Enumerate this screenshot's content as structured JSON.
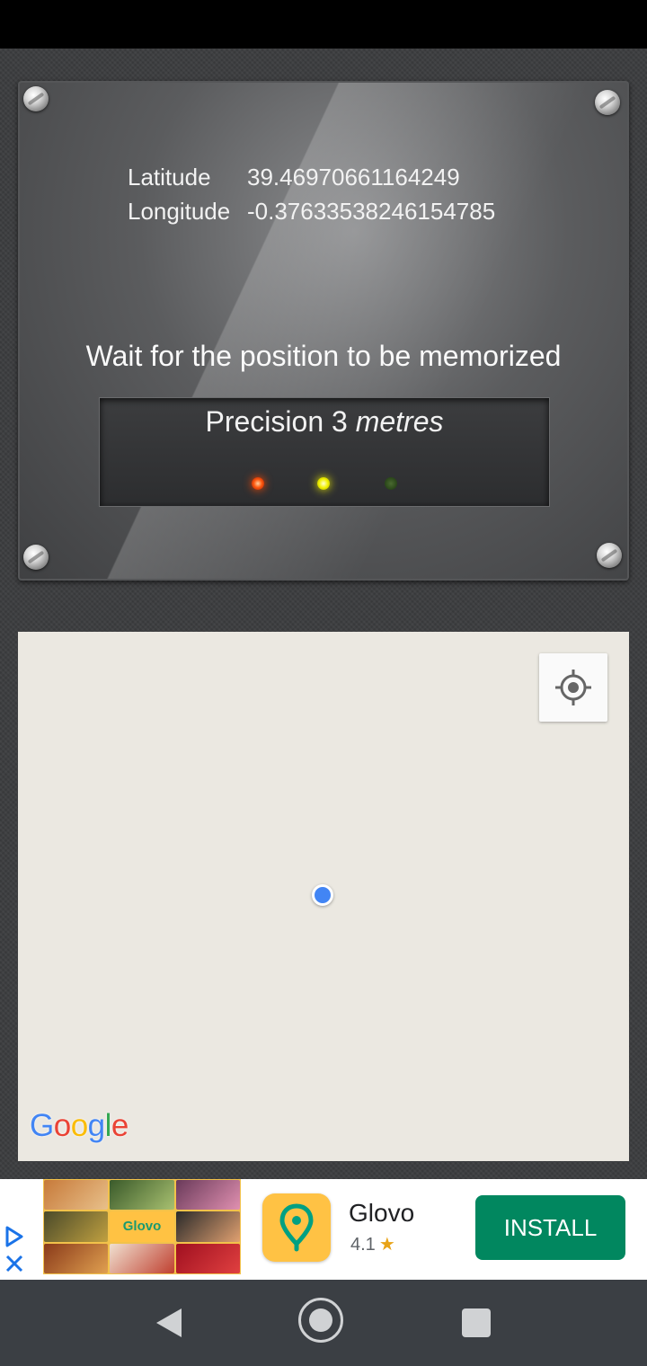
{
  "coordinates": {
    "latitude_label": "Latitude",
    "latitude_value": "39.46970661164249",
    "longitude_label": "Longitude",
    "longitude_value": "-0.37633538246154785"
  },
  "status": {
    "message": "Wait for the position to be memorized",
    "precision_prefix": "Precision 3",
    "precision_unit": "metres"
  },
  "indicators": [
    {
      "name": "red",
      "color": "#ff5a10",
      "state": "on"
    },
    {
      "name": "yellow",
      "color": "#f2f200",
      "state": "on"
    },
    {
      "name": "green",
      "color": "#2d4a1c",
      "state": "off"
    }
  ],
  "map": {
    "logo_text": "Google",
    "locate_icon": "my-location-icon",
    "location_dot_color": "#4285f4"
  },
  "ad": {
    "tile_brand": "Glovo",
    "app_name": "Glovo",
    "rating": "4.1",
    "rating_icon": "star-icon",
    "install_label": "INSTALL",
    "install_color": "#01875f"
  },
  "navbar": {
    "back_icon": "back-icon",
    "home_icon": "home-icon",
    "recents_icon": "recents-icon"
  }
}
